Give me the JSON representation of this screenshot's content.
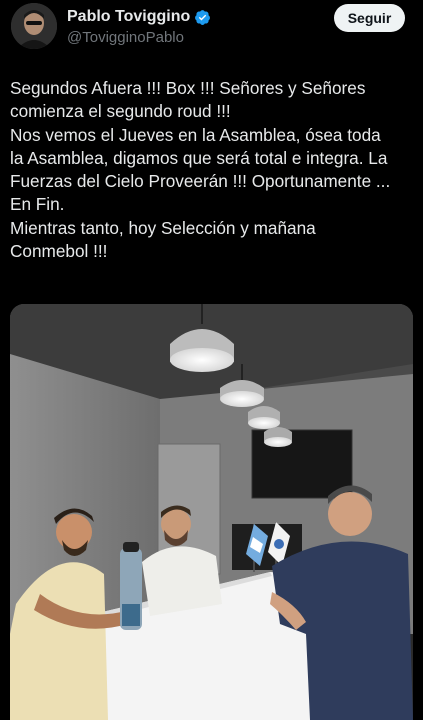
{
  "author": {
    "name": "Pablo Toviggino",
    "handle": "@TovigginoPablo",
    "verified": true
  },
  "follow_button": {
    "label": "Seguir"
  },
  "tweet": {
    "lines": [
      "Segundos Afuera !!! Box !!! Señores y Señores",
      "comienza el segundo roud !!!",
      "Nos vemos el Jueves en la Asamblea, ósea toda",
      "la Asamblea, digamos que será total e integra. La",
      "Fuerzas del Cielo Proveerán !!! Oportunamente ...",
      "En Fin.",
      "Mientras tanto, hoy Selección y mañana",
      "Conmebol !!!"
    ]
  },
  "media": {
    "description_icons": [
      "ceiling-lamp-icon",
      "argentina-flag-icon",
      "afa-flag-icon",
      "tv-icon",
      "bottle-icon"
    ]
  },
  "colors": {
    "background": "#000000",
    "text": "#e7e9ea",
    "secondary_text": "#71767b",
    "verified_blue": "#1d9bf0",
    "button_bg": "#eff3f4"
  }
}
